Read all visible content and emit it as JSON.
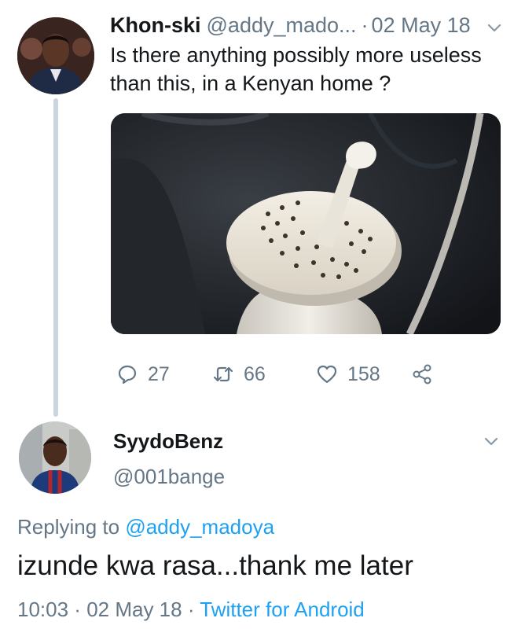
{
  "tweet": {
    "display_name": "Khon-ski",
    "handle": "@addy_mado...",
    "separator": "·",
    "date": "02 May 18",
    "text": "Is there anything possibly more useless than this, in a Kenyan home ?",
    "stats": {
      "replies": "27",
      "retweets": "66",
      "likes": "158"
    }
  },
  "reply": {
    "display_name": "SyydoBenz",
    "handle": "@001bange",
    "replying_prefix": "Replying to ",
    "replying_mention": "@addy_madoya",
    "text": "izunde kwa rasa...thank me later",
    "time": "10:03",
    "separator1": " · ",
    "date": "02 May 18",
    "separator2": " · ",
    "source": "Twitter for Android"
  },
  "icons": {
    "reply": "speech-bubble-icon",
    "retweet": "retweet-icon",
    "like": "heart-icon",
    "share": "share-icon",
    "caret": "chevron-down-icon"
  },
  "colors": {
    "text_primary": "#14171a",
    "text_secondary": "#657786",
    "link": "#1da1f2",
    "thread_line": "#cbd5de"
  }
}
